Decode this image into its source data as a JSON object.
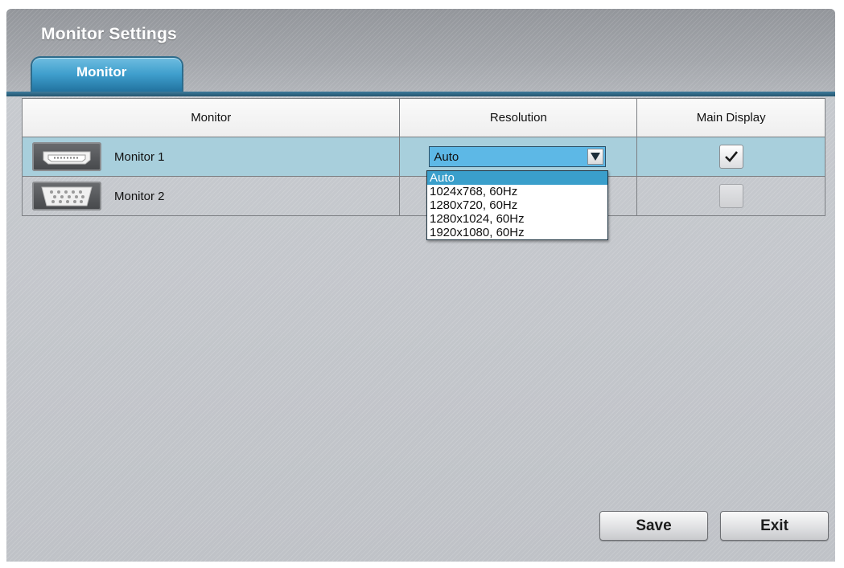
{
  "window": {
    "title": "Monitor Settings"
  },
  "tabs": [
    {
      "label": "Monitor",
      "active": true
    }
  ],
  "table": {
    "columns": [
      "Monitor",
      "Resolution",
      "Main Display"
    ],
    "rows": [
      {
        "monitor": "Monitor 1",
        "icon": "hdmi-port-icon",
        "resolution": "Auto",
        "main_display": true,
        "selected": true
      },
      {
        "monitor": "Monitor 2",
        "icon": "vga-port-icon",
        "resolution": "",
        "main_display": false,
        "selected": false
      }
    ]
  },
  "resolution_dropdown": {
    "selected": "Auto",
    "options": [
      "Auto",
      "1024x768, 60Hz",
      "1280x720, 60Hz",
      "1280x1024, 60Hz",
      "1920x1080, 60Hz"
    ],
    "highlighted_index": 0
  },
  "buttons": {
    "save": "Save",
    "exit": "Exit"
  },
  "colors": {
    "accent": "#3a9fcb",
    "selected_row": "#a8cfdc",
    "tab_blue": "#1e6c99"
  }
}
